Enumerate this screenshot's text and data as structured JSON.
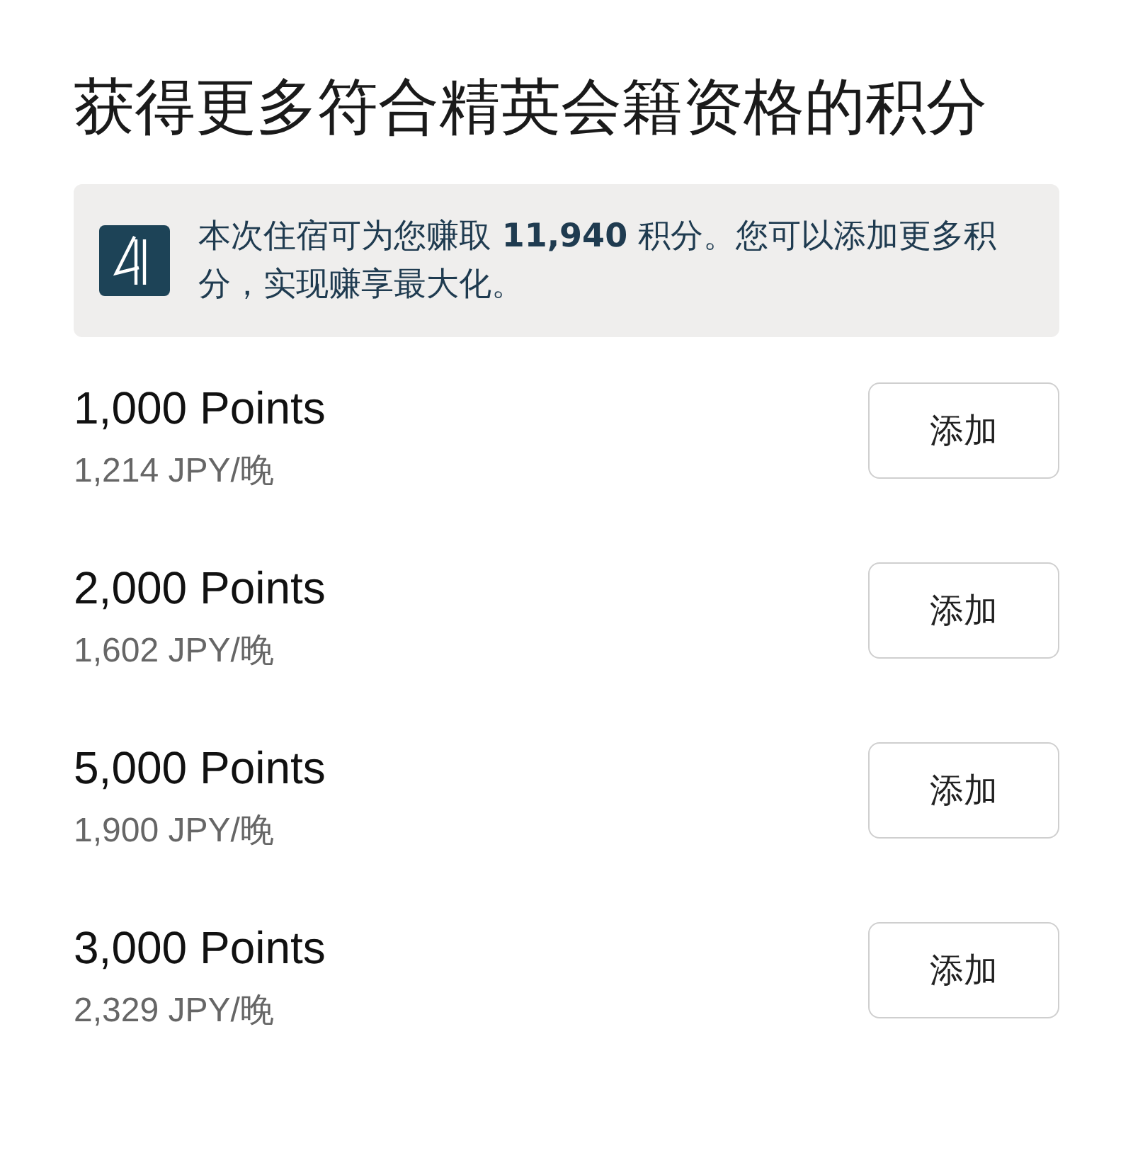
{
  "title": "获得更多符合精英会籍资格的积分",
  "banner": {
    "text": "本次住宿可为您赚取 **11,940** 积分。您可以添加更多积分，实现赚享最大化。"
  },
  "offers": [
    {
      "points": "1,000 Points",
      "price": "1,214 JPY/晚",
      "button": "添加"
    },
    {
      "points": "2,000 Points",
      "price": "1,602 JPY/晚",
      "button": "添加"
    },
    {
      "points": "5,000 Points",
      "price": "1,900 JPY/晚",
      "button": "添加"
    },
    {
      "points": "3,000 Points",
      "price": "2,329 JPY/晚",
      "button": "添加"
    }
  ]
}
